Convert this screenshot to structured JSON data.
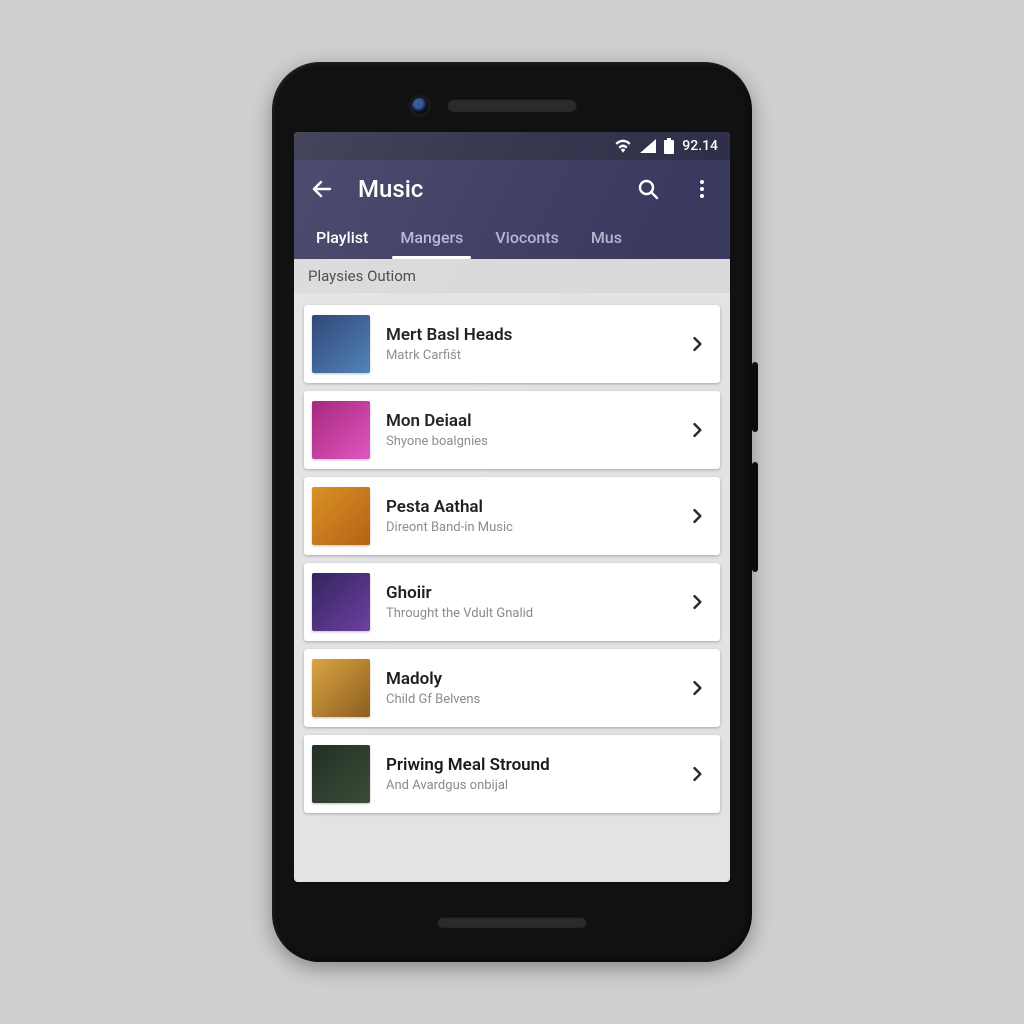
{
  "status": {
    "time": "92.14"
  },
  "appbar": {
    "title": "Music"
  },
  "tabs": [
    {
      "label": "Playlist",
      "active": true
    },
    {
      "label": "Mangers",
      "active": false,
      "indicator": true
    },
    {
      "label": "Vioconts",
      "active": false
    },
    {
      "label": "Mus",
      "active": false
    }
  ],
  "section_header": "Playsies Outiom",
  "items": [
    {
      "title": "Mert Basl Heads",
      "subtitle": "Matrk Carfišt"
    },
    {
      "title": "Mon Deiaal",
      "subtitle": "Shyone boalgnies"
    },
    {
      "title": "Pesta Aathal",
      "subtitle": "Direont Band-in Music"
    },
    {
      "title": "Ghoiir",
      "subtitle": "Throught the Vdult Gnalid"
    },
    {
      "title": "Madoly",
      "subtitle": "Child Gf Belvens"
    },
    {
      "title": "Priwing Meal Stround",
      "subtitle": "And Avardgus onbijal"
    }
  ],
  "icons": {
    "back": "back-arrow-icon",
    "search": "search-icon",
    "overflow": "more-vert-icon",
    "wifi": "wifi-icon",
    "signal": "cell-signal-icon",
    "battery": "battery-icon",
    "chevron": "chevron-right-icon"
  }
}
